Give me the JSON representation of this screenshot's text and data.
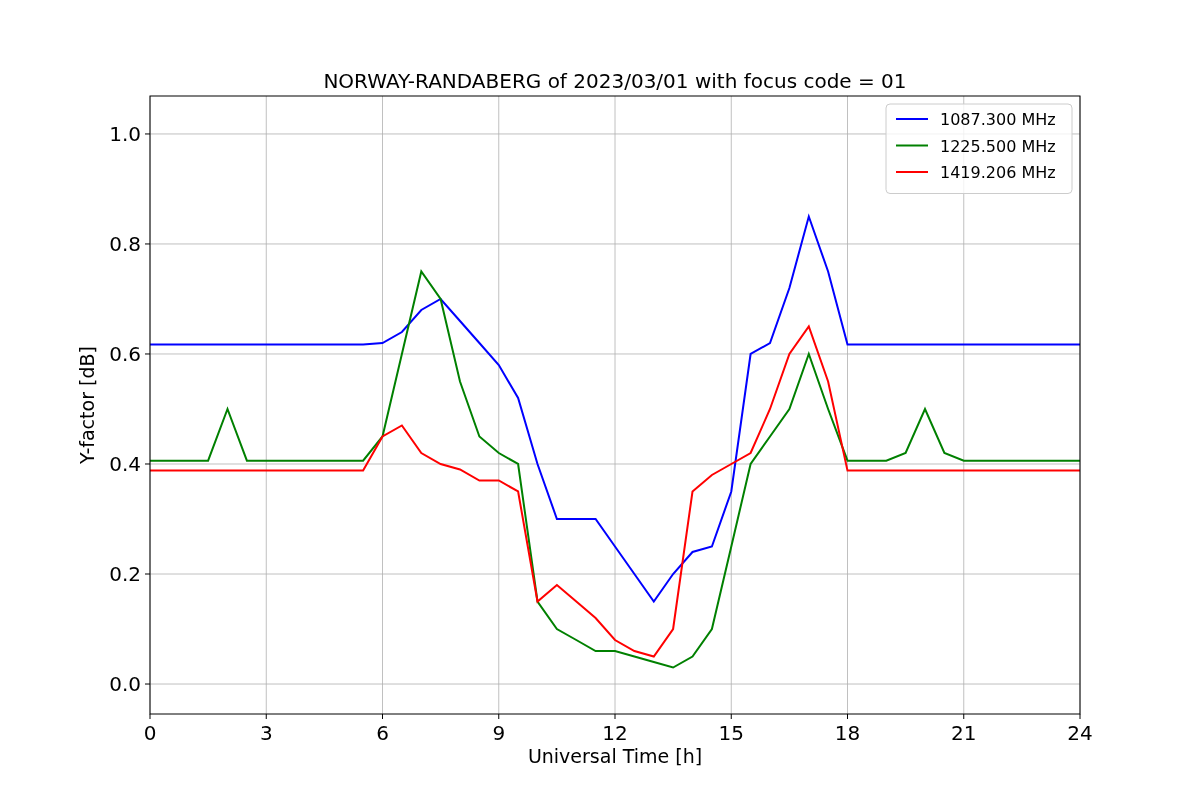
{
  "figure": {
    "chart_data": {
      "type": "line",
      "title": "NORWAY-RANDABERG of 2023/03/01 with focus code = 01",
      "xlabel": "Universal Time [h]",
      "ylabel": "Y-factor [dB]",
      "x": [
        0,
        0.5,
        1,
        1.5,
        2,
        2.5,
        3,
        3.5,
        4,
        4.5,
        5,
        5.5,
        6,
        6.5,
        7,
        7.5,
        8,
        8.5,
        9,
        9.5,
        10,
        10.5,
        11,
        11.5,
        12,
        12.5,
        13,
        13.5,
        14,
        14.5,
        15,
        15.5,
        16,
        16.5,
        17,
        17.5,
        18,
        18.5,
        19,
        19.5,
        20,
        20.5,
        21,
        21.5,
        22,
        22.5,
        23,
        23.5,
        24
      ],
      "series": [
        {
          "name": "1087.300 MHz",
          "color": "#0000ff",
          "values": [
            0.617,
            0.617,
            0.617,
            0.617,
            0.617,
            0.617,
            0.617,
            0.617,
            0.617,
            0.617,
            0.617,
            0.617,
            0.62,
            0.64,
            0.68,
            0.7,
            0.66,
            0.62,
            0.58,
            0.52,
            0.4,
            0.3,
            0.3,
            0.3,
            0.25,
            0.2,
            0.15,
            0.2,
            0.24,
            0.25,
            0.35,
            0.6,
            0.62,
            0.72,
            0.85,
            0.75,
            0.617,
            0.617,
            0.617,
            0.617,
            0.617,
            0.617,
            0.617,
            0.617,
            0.617,
            0.617,
            0.617,
            0.617,
            0.617
          ]
        },
        {
          "name": "1225.500 MHz",
          "color": "#008000",
          "values": [
            0.406,
            0.406,
            0.406,
            0.406,
            0.5,
            0.406,
            0.406,
            0.406,
            0.406,
            0.406,
            0.406,
            0.406,
            0.45,
            0.6,
            0.75,
            0.7,
            0.55,
            0.45,
            0.42,
            0.4,
            0.15,
            0.1,
            0.08,
            0.06,
            0.06,
            0.05,
            0.04,
            0.03,
            0.05,
            0.1,
            0.25,
            0.4,
            0.45,
            0.5,
            0.6,
            0.5,
            0.406,
            0.406,
            0.406,
            0.42,
            0.5,
            0.42,
            0.406,
            0.406,
            0.406,
            0.406,
            0.406,
            0.406,
            0.406
          ]
        },
        {
          "name": "1419.206 MHz",
          "color": "#ff0000",
          "values": [
            0.388,
            0.388,
            0.388,
            0.388,
            0.388,
            0.388,
            0.388,
            0.388,
            0.388,
            0.388,
            0.388,
            0.388,
            0.45,
            0.47,
            0.42,
            0.4,
            0.39,
            0.37,
            0.37,
            0.35,
            0.15,
            0.18,
            0.15,
            0.12,
            0.08,
            0.06,
            0.05,
            0.1,
            0.35,
            0.38,
            0.4,
            0.42,
            0.5,
            0.6,
            0.65,
            0.55,
            0.388,
            0.388,
            0.388,
            0.388,
            0.388,
            0.388,
            0.388,
            0.388,
            0.388,
            0.388,
            0.388,
            0.388,
            0.388
          ]
        }
      ],
      "grid": true,
      "legend": true,
      "xlim": [
        0,
        24
      ],
      "ylim": [
        -0.0545,
        1.069
      ],
      "xticks": [
        0,
        3,
        6,
        9,
        12,
        15,
        18,
        21,
        24
      ],
      "yticks": [
        {
          "value": 0,
          "label": "0.0"
        },
        {
          "value": 0.2,
          "label": "0.2"
        },
        {
          "value": 0.4,
          "label": "0.4"
        },
        {
          "value": 0.6,
          "label": "0.6"
        },
        {
          "value": 0.8,
          "label": "0.8"
        },
        {
          "value": 1.0,
          "label": "1.0"
        }
      ]
    }
  }
}
